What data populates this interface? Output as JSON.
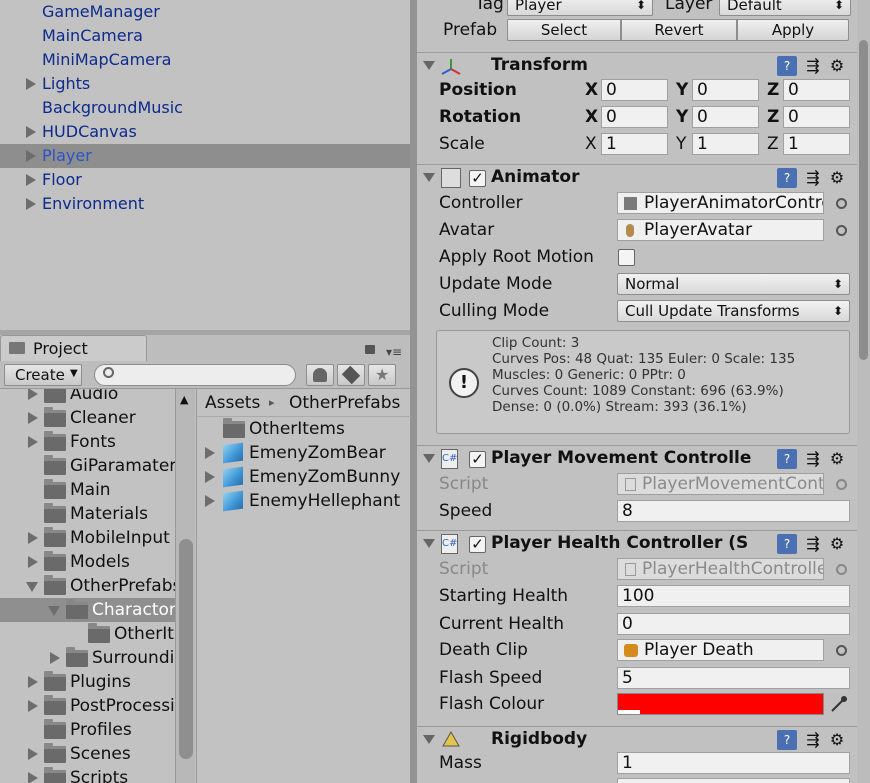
{
  "hierarchy": {
    "items": [
      {
        "label": "GameManager",
        "expandable": false
      },
      {
        "label": "MainCamera",
        "expandable": false
      },
      {
        "label": "MiniMapCamera",
        "expandable": false
      },
      {
        "label": "Lights",
        "expandable": true
      },
      {
        "label": "BackgroundMusic",
        "expandable": false
      },
      {
        "label": "HUDCanvas",
        "expandable": true
      },
      {
        "label": "Player",
        "expandable": true,
        "selected": true
      },
      {
        "label": "Floor",
        "expandable": true
      },
      {
        "label": "Environment",
        "expandable": true
      }
    ]
  },
  "project": {
    "tab_label": "Project",
    "create_label": "Create",
    "search_placeholder": "",
    "tree": [
      {
        "label": "Audio",
        "indent": 0,
        "expandable": true
      },
      {
        "label": "Cleaner",
        "indent": 0,
        "expandable": true
      },
      {
        "label": "Fonts",
        "indent": 0,
        "expandable": true
      },
      {
        "label": "GiParamater",
        "indent": 0,
        "expandable": false
      },
      {
        "label": "Main",
        "indent": 0,
        "expandable": false
      },
      {
        "label": "Materials",
        "indent": 0,
        "expandable": false
      },
      {
        "label": "MobileInput",
        "indent": 0,
        "expandable": true
      },
      {
        "label": "Models",
        "indent": 0,
        "expandable": true
      },
      {
        "label": "OtherPrefabs",
        "indent": 0,
        "expandable": "open"
      },
      {
        "label": "Charactors",
        "indent": 1,
        "expandable": "open",
        "selected": true
      },
      {
        "label": "OtherIt",
        "indent": 2,
        "expandable": false
      },
      {
        "label": "Surroundi",
        "indent": 1,
        "expandable": true
      },
      {
        "label": "Plugins",
        "indent": 0,
        "expandable": true
      },
      {
        "label": "PostProcessi",
        "indent": 0,
        "expandable": true
      },
      {
        "label": "Profiles",
        "indent": 0,
        "expandable": false
      },
      {
        "label": "Scenes",
        "indent": 0,
        "expandable": true
      },
      {
        "label": "Scripts",
        "indent": 0,
        "expandable": true
      }
    ],
    "breadcrumb": [
      "Assets",
      "OtherPrefabs"
    ],
    "assets": [
      {
        "label": "OtherItems",
        "type": "folder"
      },
      {
        "label": "EmenyZomBear",
        "type": "prefab"
      },
      {
        "label": "EmenyZomBunny",
        "type": "prefab"
      },
      {
        "label": "EnemyHellephant",
        "type": "prefab"
      }
    ]
  },
  "inspector": {
    "tag_label": "Tag",
    "tag_value": "Player",
    "layer_label": "Layer",
    "layer_value": "Default",
    "prefab_label": "Prefab",
    "prefab_buttons": [
      "Select",
      "Revert",
      "Apply"
    ],
    "transform": {
      "title": "Transform",
      "position_label": "Position",
      "rotation_label": "Rotation",
      "scale_label": "Scale",
      "axes": [
        "X",
        "Y",
        "Z"
      ],
      "position": [
        "0",
        "0",
        "0"
      ],
      "rotation": [
        "0",
        "0",
        "0"
      ],
      "scale": [
        "1",
        "1",
        "1"
      ]
    },
    "animator": {
      "title": "Animator",
      "controller_label": "Controller",
      "controller_value": "PlayerAnimatorContro",
      "avatar_label": "Avatar",
      "avatar_value": "PlayerAvatar",
      "apply_root_label": "Apply Root Motion",
      "update_mode_label": "Update Mode",
      "update_mode_value": "Normal",
      "culling_mode_label": "Culling Mode",
      "culling_mode_value": "Cull Update Transforms",
      "info": [
        "Clip Count: 3",
        "Curves Pos: 48 Quat: 135 Euler: 0 Scale: 135",
        "Muscles: 0 Generic: 0 PPtr: 0",
        "Curves Count: 1089 Constant: 696 (63.9%)",
        "Dense: 0 (0.0%) Stream: 393 (36.1%)"
      ]
    },
    "movement": {
      "title": "Player Movement Controlle",
      "script_label": "Script",
      "script_value": "PlayerMovementCont",
      "speed_label": "Speed",
      "speed_value": "8"
    },
    "health": {
      "title": "Player Health Controller (S",
      "script_label": "Script",
      "script_value": "PlayerHealthControlle",
      "starting_label": "Starting Health",
      "starting_value": "100",
      "current_label": "Current Health",
      "current_value": "0",
      "death_label": "Death Clip",
      "death_value": "Player Death",
      "flash_speed_label": "Flash Speed",
      "flash_speed_value": "5",
      "flash_colour_label": "Flash Colour",
      "flash_colour": "#ff0000"
    },
    "rigidbody": {
      "title": "Rigidbody",
      "mass_label": "Mass",
      "mass_value": "1"
    }
  }
}
